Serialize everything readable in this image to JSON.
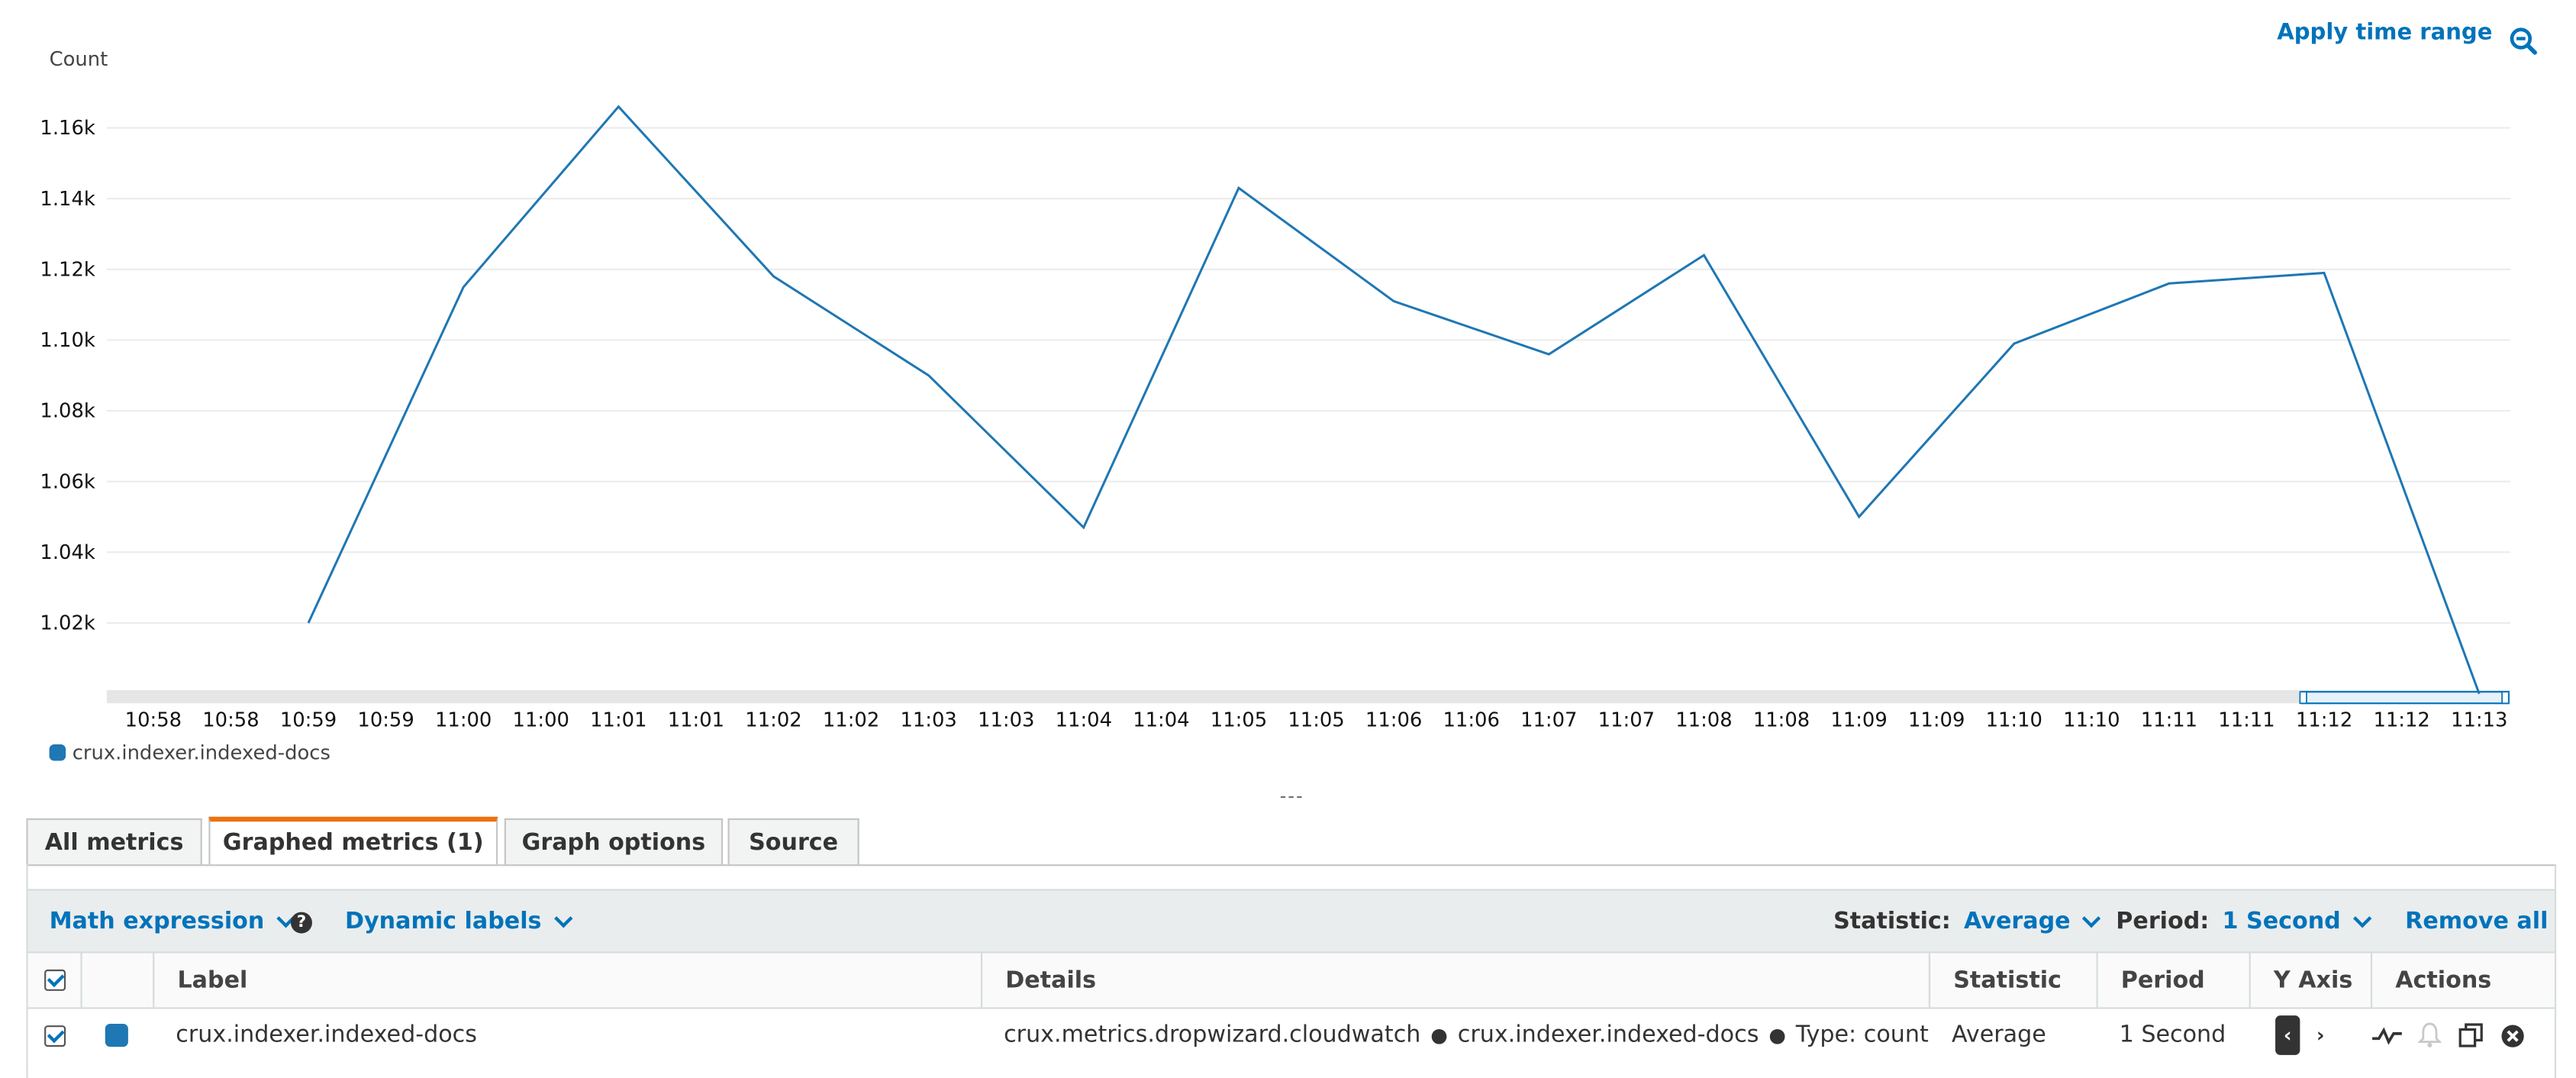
{
  "chart_header": {
    "apply_time_range": "Apply time range",
    "zoom_icon": "zoom-out-icon"
  },
  "chart_data": {
    "type": "line",
    "ylabel": "Count",
    "y_ticks": [
      "1.16k",
      "1.14k",
      "1.12k",
      "1.10k",
      "1.08k",
      "1.06k",
      "1.04k",
      "1.02k"
    ],
    "y_tick_values": [
      1160,
      1140,
      1120,
      1100,
      1080,
      1060,
      1040,
      1020
    ],
    "ylim": [
      1001,
      1172
    ],
    "x_ticks": [
      "10:58",
      "10:58",
      "10:59",
      "10:59",
      "11:00",
      "11:00",
      "11:01",
      "11:01",
      "11:02",
      "11:02",
      "11:03",
      "11:03",
      "11:04",
      "11:04",
      "11:05",
      "11:05",
      "11:06",
      "11:06",
      "11:07",
      "11:07",
      "11:08",
      "11:08",
      "11:09",
      "11:09",
      "11:10",
      "11:10",
      "11:11",
      "11:11",
      "11:12",
      "11:12",
      "11:13"
    ],
    "x_tick_times": [
      "10:58:00",
      "10:58:30",
      "10:59:00",
      "10:59:30",
      "11:00:00",
      "11:00:30",
      "11:01:00",
      "11:01:30",
      "11:02:00",
      "11:02:30",
      "11:03:00",
      "11:03:30",
      "11:04:00",
      "11:04:30",
      "11:05:00",
      "11:05:30",
      "11:06:00",
      "11:06:30",
      "11:07:00",
      "11:07:30",
      "11:08:00",
      "11:08:30",
      "11:09:00",
      "11:09:30",
      "11:10:00",
      "11:10:30",
      "11:11:00",
      "11:11:30",
      "11:12:00",
      "11:12:30",
      "11:13:00"
    ],
    "xlim": [
      "10:57:42",
      "11:13:12"
    ],
    "grid": true,
    "legend_position": "bottom-left",
    "series": [
      {
        "name": "crux.indexer.indexed-docs",
        "color": "#1f77b4",
        "x": [
          "10:59:00",
          "11:00:00",
          "11:01:00",
          "11:02:00",
          "11:03:00",
          "11:04:00",
          "11:05:00",
          "11:06:00",
          "11:07:00",
          "11:08:00",
          "11:09:00",
          "11:10:00",
          "11:11:00",
          "11:12:00",
          "11:13:00"
        ],
        "y": [
          1020,
          1115,
          1166,
          1118,
          1090,
          1047,
          1143,
          1111,
          1096,
          1124,
          1050,
          1099,
          1116,
          1119,
          1000
        ]
      }
    ]
  },
  "legend": {
    "label": "crux.indexer.indexed-docs",
    "color": "#1f77b4"
  },
  "resize_handle": "---",
  "tabs": [
    {
      "label": "All metrics",
      "active": false
    },
    {
      "label": "Graphed metrics (1)",
      "active": true
    },
    {
      "label": "Graph options",
      "active": false
    },
    {
      "label": "Source",
      "active": false
    }
  ],
  "toolbar": {
    "math_expression": "Math expression",
    "dynamic_labels": "Dynamic labels",
    "statistic_label": "Statistic:",
    "statistic_value": "Average",
    "period_label": "Period:",
    "period_value": "1 Second",
    "remove_all": "Remove all"
  },
  "table": {
    "headers": {
      "label": "Label",
      "details": "Details",
      "statistic": "Statistic",
      "period": "Period",
      "y_axis": "Y Axis",
      "actions": "Actions"
    },
    "rows": [
      {
        "checked": true,
        "color": "#1f77b4",
        "label": "crux.indexer.indexed-docs",
        "details_namespace": "crux.metrics.dropwizard.cloudwatch",
        "details_metric": "crux.indexer.indexed-docs",
        "details_type": "Type: count",
        "statistic": "Average",
        "period": "1 Second",
        "y_axis_left": "‹",
        "y_axis_right": "›"
      }
    ]
  },
  "colors": {
    "accent": "#0073bb",
    "active_tab": "#ec7211",
    "line": "#1f77b4"
  }
}
